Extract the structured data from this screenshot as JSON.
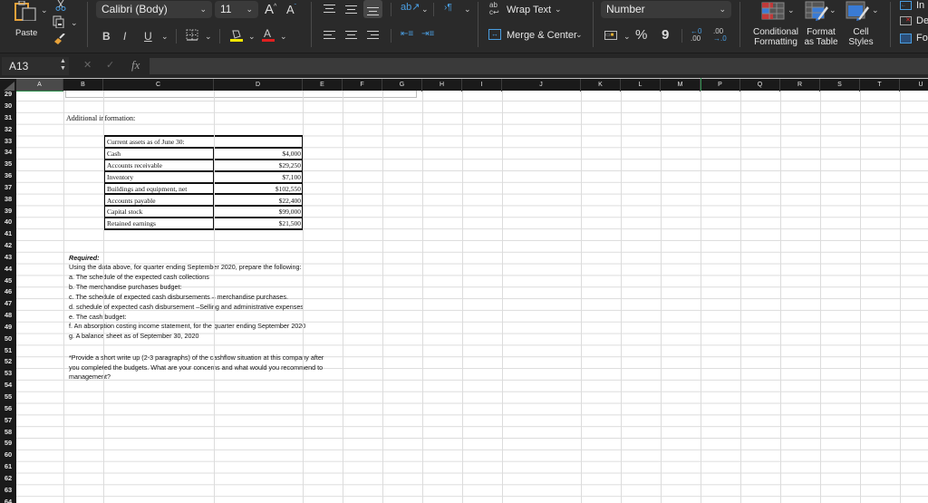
{
  "ribbon": {
    "paste_label": "Paste",
    "font_name": "Calibri (Body)",
    "font_size": "11",
    "grow_font": "A",
    "shrink_font": "A",
    "bold": "B",
    "italic": "I",
    "underline": "U",
    "font_color_letter": "A",
    "highlight_color": "#f2e600",
    "font_color": "#e02020",
    "wrap_text_label": "Wrap Text",
    "merge_center_label": "Merge & Center",
    "number_format": "Number",
    "percent": "%",
    "comma": "9",
    "conditional_formatting": [
      "Conditional",
      "Formatting"
    ],
    "format_as_table": [
      "Format",
      "as Table"
    ],
    "cell_styles": [
      "Cell",
      "Styles"
    ],
    "insert_label": "In",
    "delete_label": "De",
    "format_label": "Fo"
  },
  "formula_bar": {
    "name_box": "A13",
    "cancel": "✕",
    "enter": "✓",
    "fx": "fx",
    "content": ""
  },
  "columns": [
    "A",
    "B",
    "C",
    "D",
    "E",
    "F",
    "G",
    "H",
    "I",
    "J",
    "K",
    "L",
    "M",
    "P",
    "Q",
    "R",
    "S",
    "T",
    "U"
  ],
  "selected_column": "A",
  "rows": [
    "29",
    "30",
    "31",
    "32",
    "33",
    "34",
    "35",
    "36",
    "37",
    "38",
    "39",
    "40",
    "41",
    "42",
    "43",
    "44",
    "45",
    "46",
    "47",
    "48",
    "49",
    "50",
    "51",
    "52",
    "53",
    "54",
    "55",
    "56",
    "57",
    "58",
    "59",
    "60",
    "61",
    "62",
    "63",
    "64"
  ],
  "sheet": {
    "additional_info": "Additional information:",
    "assets_table": {
      "header": "Current assets as of June 30:",
      "items": [
        {
          "label": "Cash",
          "value": "$4,000"
        },
        {
          "label": "Accounts receivable",
          "value": "$29,250"
        },
        {
          "label": "Inventory",
          "value": "$7,100"
        },
        {
          "label": "Buildings and equipment, net",
          "value": "$102,550"
        },
        {
          "label": "Accounts payable",
          "value": "$22,400"
        },
        {
          "label": "Capital stock",
          "value": "$99,000"
        },
        {
          "label": "Retained earnings",
          "value": "$21,500"
        }
      ]
    },
    "required_title": "Required:",
    "required_lines": [
      "Using the data above, for quarter ending September 2020, prepare the following:",
      "a. The schedule of the expected cash collections",
      "b. The merchandise purchases budget:",
      "c. The schedule of expected cash disbursements – merchandise purchases.",
      "d. schedule of expected cash disbursement –Selling and administrative expenses",
      "e. The cash budget:",
      "f. An absorption costing income statement,  for the quarter ending September 2020",
      "g. A balance sheet as of September 30, 2020"
    ],
    "writeup_lines": [
      "*Provide a short write up (2-3 paragraphs) of the cashflow situation at this company after",
      "you completed the budgets. What are your concerns and what would you recommend to",
      "management?"
    ]
  }
}
